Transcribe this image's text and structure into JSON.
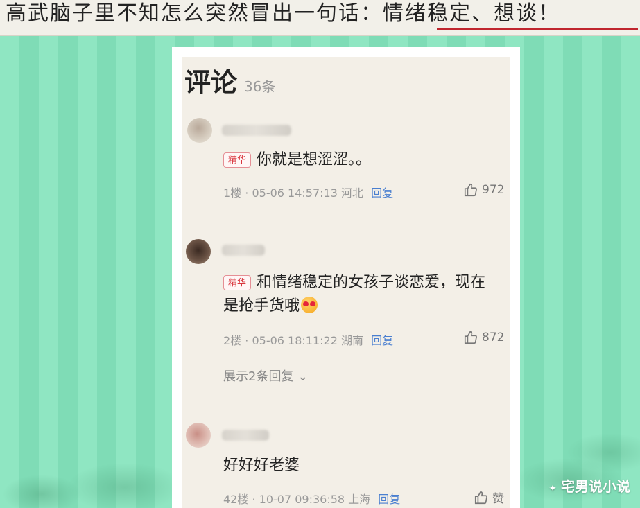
{
  "headline": "高武脑子里不知怎么突然冒出一句话：情绪稳定、想谈！",
  "comments_section": {
    "title": "评论",
    "count": "36条"
  },
  "comments": [
    {
      "badge": "精华",
      "text": "你就是想涩涩。。",
      "floor": "1楼",
      "datetime": "05-06 14:57:13",
      "location": "河北",
      "reply_label": "回复",
      "likes": "972"
    },
    {
      "badge": "精华",
      "text_line1": "和情绪稳定的女孩子谈恋爱，现在",
      "text_line2": "是抢手货哦",
      "emoji": "heart-eyes-emoji",
      "floor": "2楼",
      "datetime": "05-06 18:11:22",
      "location": "湖南",
      "reply_label": "回复",
      "likes": "872",
      "expand_label": "展示2条回复"
    },
    {
      "text": "好好好老婆",
      "floor": "42楼",
      "datetime": "10-07 09:36:58",
      "location": "上海",
      "reply_label": "回复",
      "likes": "赞"
    }
  ],
  "watermark": "宅男说小说",
  "colors": {
    "background_green": "#8fe6c2",
    "card_bg": "#f3efe7",
    "badge_red": "#d9363e",
    "reply_blue": "#4a7fd0",
    "underline_red": "#c0262e"
  }
}
